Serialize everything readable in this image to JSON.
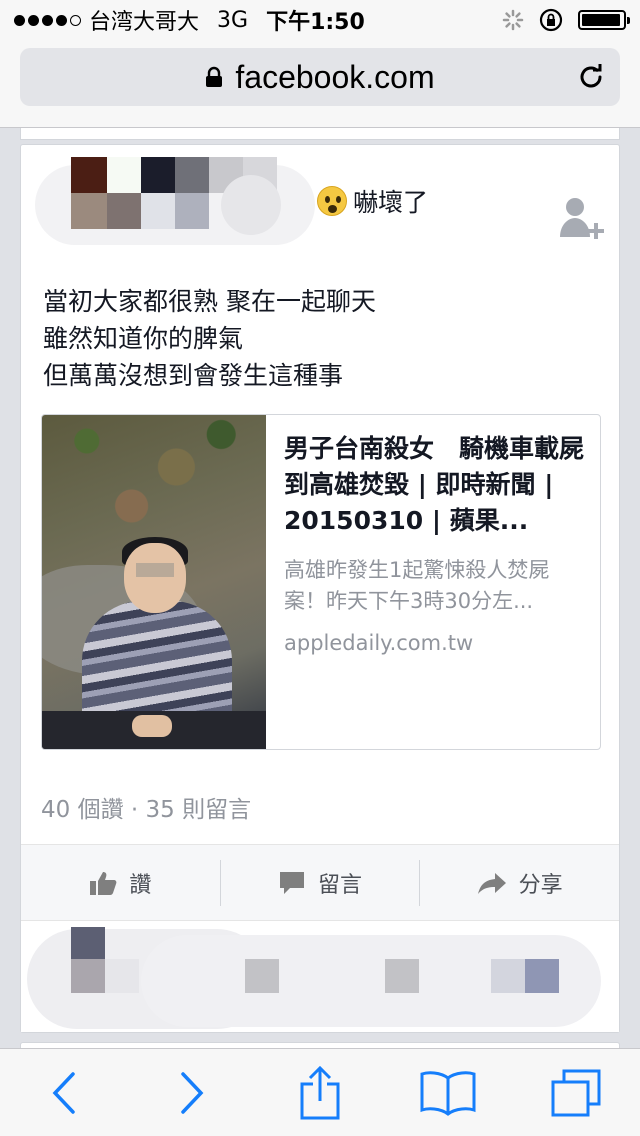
{
  "status_bar": {
    "carrier": "台湾大哥大",
    "network": "3G",
    "time": "下午1:50",
    "signal_bars_filled": 4,
    "signal_bars_total": 5,
    "battery_level": 0.95
  },
  "address_bar": {
    "url": "facebook.com",
    "lock_icon": "lock-icon",
    "reload_icon": "reload-icon"
  },
  "post": {
    "feeling_emoji": "fearful-face-icon",
    "feeling_text": "嚇壞了",
    "message_lines": [
      "當初大家都很熟 聚在一起聊天",
      "雖然知道你的脾氣",
      "但萬萬沒想到會發生這種事"
    ],
    "link": {
      "title": "男子台南殺女　騎機車載屍到高雄焚毀 | 即時新聞 | 20150310 | 蘋果...",
      "description": "高雄昨發生1起驚悚殺人焚屍案！昨天下午3時30分左...",
      "domain": "appledaily.com.tw"
    },
    "stats": "40 個讚 · 35 則留言",
    "actions": {
      "like": "讚",
      "comment": "留言",
      "share": "分享"
    }
  },
  "colors": {
    "background": "#dfe1e6",
    "secondary_text": "#90949c",
    "ios_blue": "#157efb"
  }
}
